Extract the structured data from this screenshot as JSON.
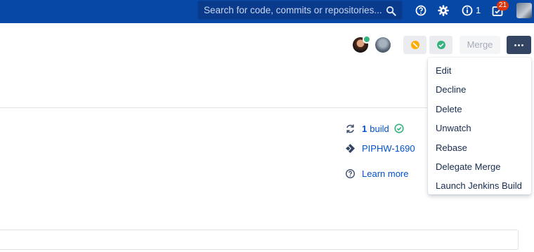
{
  "topbar": {
    "search_placeholder": "Search for code, commits or repositories...",
    "notification_count": "1",
    "inbox_badge": "21"
  },
  "header": {
    "merge_label": "Merge"
  },
  "sidebar": {
    "build_count": "1",
    "build_label": "build",
    "jira_issue": "PIPHW-1690",
    "learn_more": "Learn more"
  },
  "dropdown": {
    "items": [
      "Edit",
      "Decline",
      "Delete",
      "Unwatch",
      "Rebase",
      "Delegate Merge",
      "Launch Jenkins Build"
    ]
  },
  "colors": {
    "topbar": "#0747a6",
    "accent_link": "#0052cc",
    "success": "#36b37e",
    "warning": "#ffab00",
    "more_button": "#344563"
  }
}
